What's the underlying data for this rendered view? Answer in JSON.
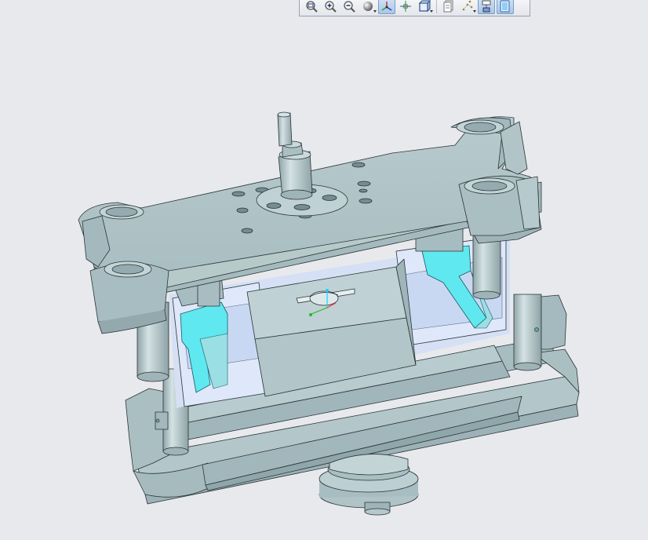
{
  "app": {
    "viewport_background": "#e8e9ed",
    "model_color": "#b5c9cc",
    "highlight_color": "#5fe8f0"
  },
  "toolbar": {
    "buttons": [
      {
        "icon": "zoom-fit-icon",
        "active": false
      },
      {
        "icon": "zoom-in-icon",
        "active": false
      },
      {
        "icon": "zoom-out-icon",
        "active": false
      },
      {
        "icon": "shading-icon",
        "active": false,
        "dropdown": true
      },
      {
        "icon": "view-orient-icon",
        "active": true
      },
      {
        "icon": "spin-center-icon",
        "active": false
      },
      {
        "icon": "saved-views-icon",
        "active": false,
        "dropdown": true
      },
      {
        "icon": "layers-icon",
        "active": false
      },
      {
        "icon": "datum-display-icon",
        "active": false,
        "dropdown": true
      },
      {
        "icon": "model-tree-icon",
        "active": false
      },
      {
        "icon": "appearance-icon",
        "active": true
      }
    ]
  }
}
